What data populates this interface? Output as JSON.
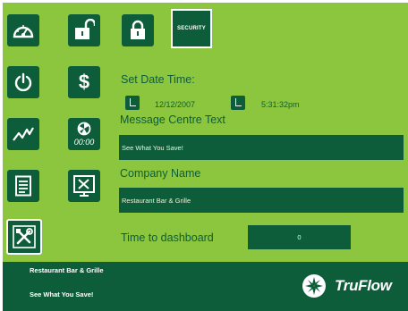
{
  "sidebar": {
    "col1": [
      {
        "id": "dashboard",
        "icon": "speedometer-icon"
      },
      {
        "id": "power",
        "icon": "power-icon"
      },
      {
        "id": "trends",
        "icon": "trend-line-icon"
      },
      {
        "id": "reports",
        "icon": "document-icon"
      },
      {
        "id": "settings",
        "icon": "tools-icon",
        "selected": true
      }
    ],
    "col2": [
      {
        "id": "unlock",
        "icon": "unlock-icon"
      },
      {
        "id": "pricing",
        "icon": "dollar-icon"
      },
      {
        "id": "timer",
        "icon": "clock-icon",
        "text": "00:00"
      },
      {
        "id": "display",
        "icon": "monitor-tools-icon"
      }
    ]
  },
  "header": {
    "lock_icon": "lock-icon",
    "security_tab_label": "SECURITY"
  },
  "form": {
    "datetime_label": "Set Date Time:",
    "date_value": "12/12/2007",
    "time_value": "5:31:32pm",
    "message_label": "Message Centre Text",
    "message_value": "See What You Save!",
    "company_label": "Company Name",
    "company_value": "Restaurant Bar & Grille",
    "dashboard_time_label": "Time to dashboard",
    "dashboard_time_value": "0"
  },
  "footer": {
    "line1": "Restaurant Bar & Grille",
    "line2": "See What You Save!",
    "brand": "TruFlow",
    "brand_icon": "truflow-logo-icon"
  },
  "colors": {
    "background": "#8cc63e",
    "accent": "#0d5d3a",
    "text_on_accent": "#ffffff"
  }
}
